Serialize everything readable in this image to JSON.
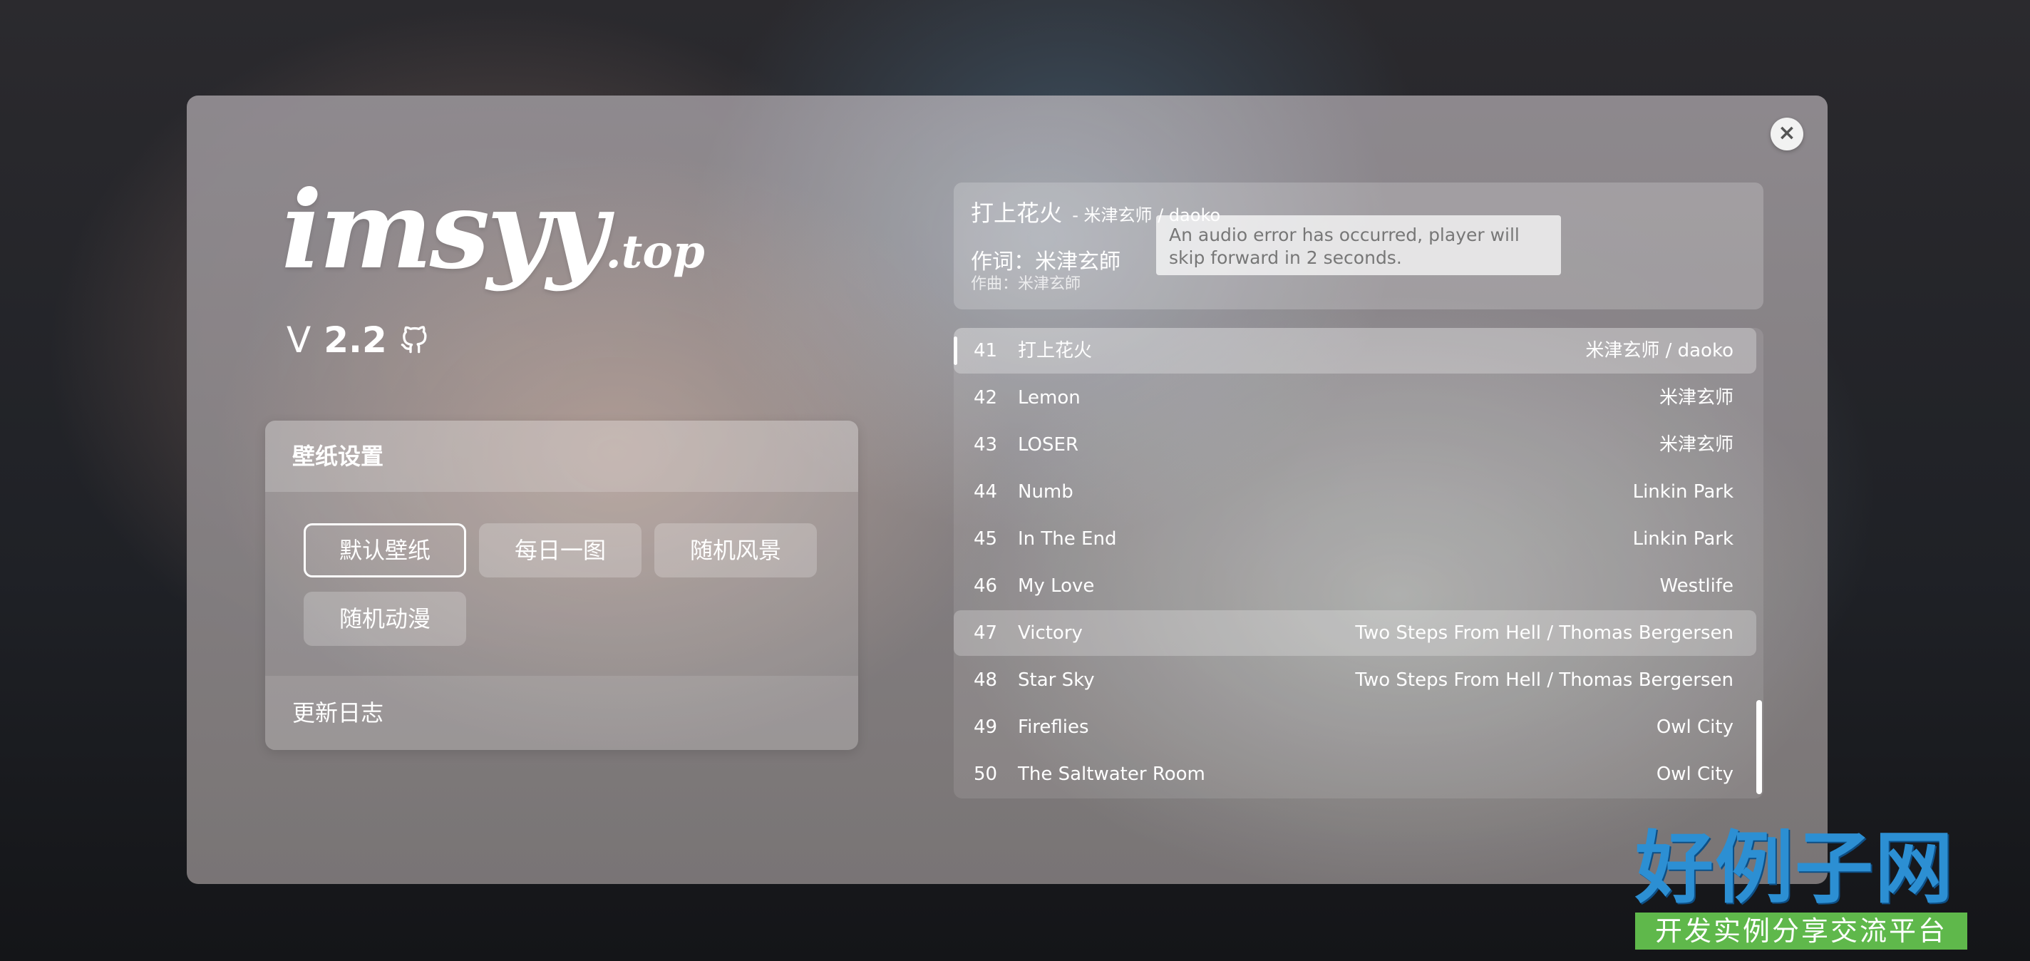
{
  "app": {
    "logo_main": "imsyy",
    "logo_tld": ".top",
    "version_prefix": "V",
    "version_number": "2.2"
  },
  "settings": {
    "title": "壁纸设置",
    "wallpaper_options": [
      "默认壁纸",
      "每日一图",
      "随机风景",
      "随机动漫"
    ],
    "selected_option": "默认壁纸",
    "changelog_label": "更新日志"
  },
  "now_playing": {
    "title": "打上花火",
    "artist": "- 米津玄师 / daoko",
    "lyric": "作词：米津玄師",
    "composer": "作曲：米津玄師"
  },
  "toast": {
    "message": "An audio error has occurred, player will skip forward in 2 seconds."
  },
  "playlist": {
    "rows": [
      {
        "num": "41",
        "song": "打上花火",
        "artist": "米津玄师 / daoko"
      },
      {
        "num": "42",
        "song": "Lemon",
        "artist": "米津玄师"
      },
      {
        "num": "43",
        "song": "LOSER",
        "artist": "米津玄师"
      },
      {
        "num": "44",
        "song": "Numb",
        "artist": "Linkin Park"
      },
      {
        "num": "45",
        "song": "In The End",
        "artist": "Linkin Park"
      },
      {
        "num": "46",
        "song": "My Love",
        "artist": "Westlife"
      },
      {
        "num": "47",
        "song": "Victory",
        "artist": "Two Steps From Hell / Thomas Bergersen"
      },
      {
        "num": "48",
        "song": "Star Sky",
        "artist": "Two Steps From Hell / Thomas Bergersen"
      },
      {
        "num": "49",
        "song": "Fireflies",
        "artist": "Owl City"
      },
      {
        "num": "50",
        "song": "The Saltwater Room",
        "artist": "Owl City"
      }
    ]
  },
  "watermark": {
    "title": "好例子网",
    "subtitle": "开发实例分享交流平台"
  },
  "icons": {
    "close": "close-icon",
    "github": "github-icon"
  }
}
